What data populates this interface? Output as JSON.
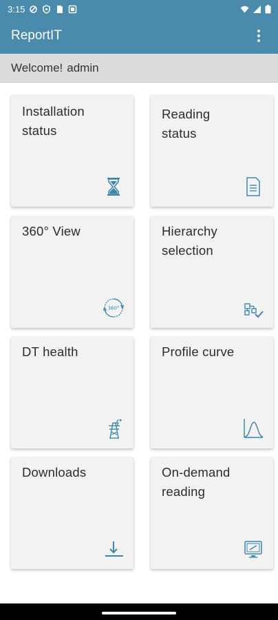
{
  "status_bar": {
    "time": "3:15",
    "icons": [
      "vpn-icon",
      "shield-icon",
      "sim-card-icon",
      "app-notification-icon",
      "wifi-icon",
      "signal-icon",
      "battery-icon"
    ]
  },
  "app_bar": {
    "title": "ReportIT",
    "overflow_icon": "more-vert-icon"
  },
  "welcome": {
    "greeting": "Welcome!",
    "user": "admin"
  },
  "tiles": [
    {
      "label": "Installation\nstatus",
      "icon": "hourglass-icon"
    },
    {
      "label": "Reading\nstatus",
      "icon": "document-icon"
    },
    {
      "label": "360°  View",
      "icon": "rotate-360-icon"
    },
    {
      "label": "Hierarchy\nselection",
      "icon": "hierarchy-check-icon"
    },
    {
      "label": "DT health",
      "icon": "transformer-tower-icon"
    },
    {
      "label": "Profile curve",
      "icon": "bell-curve-icon"
    },
    {
      "label": "Downloads",
      "icon": "download-icon"
    },
    {
      "label": "On-demand\nreading",
      "icon": "monitor-icon"
    }
  ],
  "colors": {
    "primary": "#4a8aab",
    "icon": "#3d86aa",
    "tile_bg": "#f2f2f2",
    "welcome_bg": "#dcdcdc"
  }
}
